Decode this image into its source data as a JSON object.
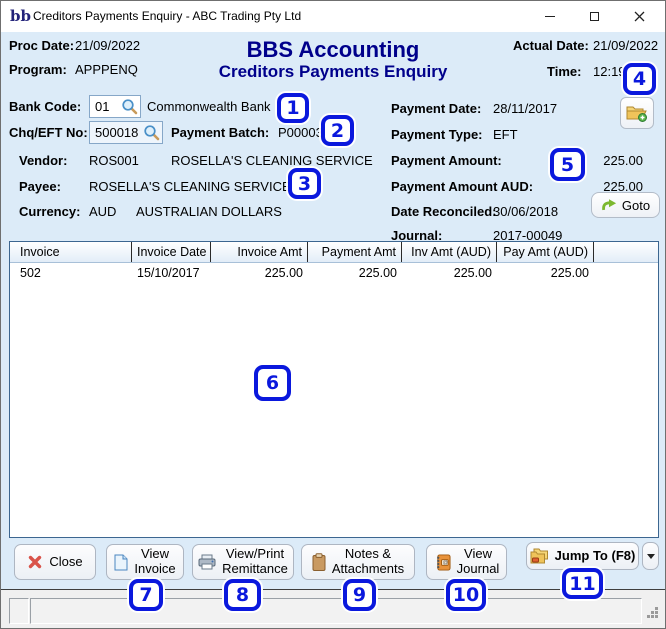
{
  "colors": {
    "header_navy": "#00008b",
    "callout_blue": "#0a18dd",
    "window_bg": "#dcebf8",
    "status_bg": "#f0f0f0"
  },
  "window": {
    "title": "Creditors Payments Enquiry - ABC Trading Pty Ltd",
    "logo_text": "bb"
  },
  "header": {
    "proc_date_label": "Proc Date:",
    "proc_date": "21/09/2022",
    "program_label": "Program:",
    "program": "APPPENQ",
    "app_title": "BBS Accounting",
    "screen_title": "Creditors Payments Enquiry",
    "actual_date_label": "Actual Date:",
    "actual_date": "21/09/2022",
    "time_label": "Time:",
    "time": "12:19"
  },
  "fields": {
    "bank_code": {
      "label": "Bank Code:",
      "value": "01",
      "name": "Commonwealth Bank"
    },
    "chq_eft_no": {
      "label": "Chq/EFT No:",
      "value": "500018"
    },
    "payment_batch": {
      "label": "Payment Batch:",
      "value": "P00003"
    },
    "vendor": {
      "label": "Vendor:",
      "code": "ROS001",
      "name": "ROSELLA'S CLEANING SERVICE"
    },
    "payee": {
      "label": "Payee:",
      "value": "ROSELLA'S CLEANING SERVICE"
    },
    "currency": {
      "label": "Currency:",
      "code": "AUD",
      "name": "AUSTRALIAN DOLLARS"
    },
    "payment_date": {
      "label": "Payment Date:",
      "value": "28/11/2017"
    },
    "payment_type": {
      "label": "Payment Type:",
      "value": "EFT"
    },
    "payment_amount": {
      "label": "Payment Amount:",
      "value": "225.00"
    },
    "payment_amount_aud": {
      "label": "Payment Amount AUD:",
      "value": "225.00"
    },
    "date_reconciled": {
      "label": "Date Reconciled:",
      "value": "30/06/2018"
    },
    "journal": {
      "label": "Journal:",
      "value": "2017-00049"
    }
  },
  "table": {
    "columns": [
      "Invoice",
      "Invoice Date",
      "Invoice Amt",
      "Payment Amt",
      "Inv Amt (AUD)",
      "Pay Amt (AUD)"
    ],
    "rows": [
      [
        "502",
        "15/10/2017",
        "225.00",
        "225.00",
        "225.00",
        "225.00"
      ]
    ]
  },
  "buttons": {
    "close": "Close",
    "view_invoice": "View\nInvoice",
    "view_print_remittance": "View/Print\nRemittance",
    "notes_attachments": "Notes &\nAttachments",
    "view_journal": "View\nJournal",
    "jump_to": "Jump To (F8)",
    "goto": "Goto"
  },
  "callouts": [
    "1",
    "2",
    "3",
    "4",
    "5",
    "6",
    "7",
    "8",
    "9",
    "10",
    "11"
  ]
}
